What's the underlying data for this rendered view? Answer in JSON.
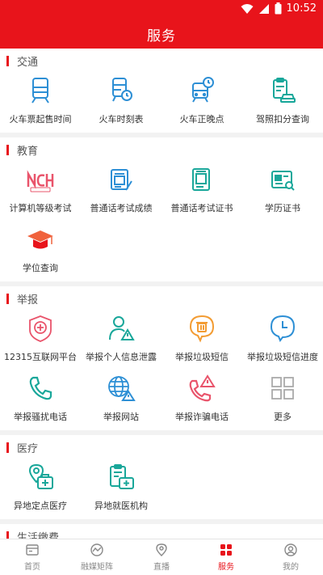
{
  "status_bar": {
    "time": "10:52"
  },
  "header": {
    "title": "服务"
  },
  "colors": {
    "brand": "#e8141b",
    "icon_blue": "#2d8fd5",
    "icon_teal": "#19a79a",
    "icon_orange": "#f39c33",
    "icon_pink": "#e9546b"
  },
  "sections": [
    {
      "title": "交通",
      "items": [
        {
          "label": "火车票起售时间",
          "icon": "train-icon"
        },
        {
          "label": "火车时刻表",
          "icon": "train-schedule-icon"
        },
        {
          "label": "火车正晚点",
          "icon": "train-clock-icon"
        },
        {
          "label": "驾照扣分查询",
          "icon": "car-license-icon"
        }
      ]
    },
    {
      "title": "教育",
      "items": [
        {
          "label": "计算机等级考试",
          "icon": "ncre-logo-icon"
        },
        {
          "label": "普通话考试成绩",
          "icon": "mandarin-score-icon"
        },
        {
          "label": "普通话考试证书",
          "icon": "mandarin-certificate-icon"
        },
        {
          "label": "学历证书",
          "icon": "diploma-icon"
        },
        {
          "label": "学位查询",
          "icon": "graduation-cap-icon"
        }
      ]
    },
    {
      "title": "举报",
      "items": [
        {
          "label": "12315互联网平台",
          "icon": "consumer-badge-icon"
        },
        {
          "label": "举报个人信息泄露",
          "icon": "person-warning-icon"
        },
        {
          "label": "举报垃圾短信",
          "icon": "spam-sms-icon"
        },
        {
          "label": "举报垃圾短信进度",
          "icon": "clock-icon"
        },
        {
          "label": "举报骚扰电话",
          "icon": "phone-icon"
        },
        {
          "label": "举报网站",
          "icon": "globe-warning-icon"
        },
        {
          "label": "举报诈骗电话",
          "icon": "phone-warning-icon"
        },
        {
          "label": "更多",
          "icon": "grid-more-icon"
        }
      ]
    },
    {
      "title": "医疗",
      "items": [
        {
          "label": "异地定点医疗",
          "icon": "medical-location-icon"
        },
        {
          "label": "异地就医机构",
          "icon": "medical-clipboard-icon"
        }
      ]
    },
    {
      "title": "生活缴费",
      "items": []
    }
  ],
  "tabs": [
    {
      "label": "首页",
      "icon": "home-icon",
      "active": false
    },
    {
      "label": "融媒矩阵",
      "icon": "media-matrix-icon",
      "active": false
    },
    {
      "label": "直播",
      "icon": "live-location-icon",
      "active": false
    },
    {
      "label": "服务",
      "icon": "services-grid-icon",
      "active": true
    },
    {
      "label": "我的",
      "icon": "profile-icon",
      "active": false
    }
  ]
}
